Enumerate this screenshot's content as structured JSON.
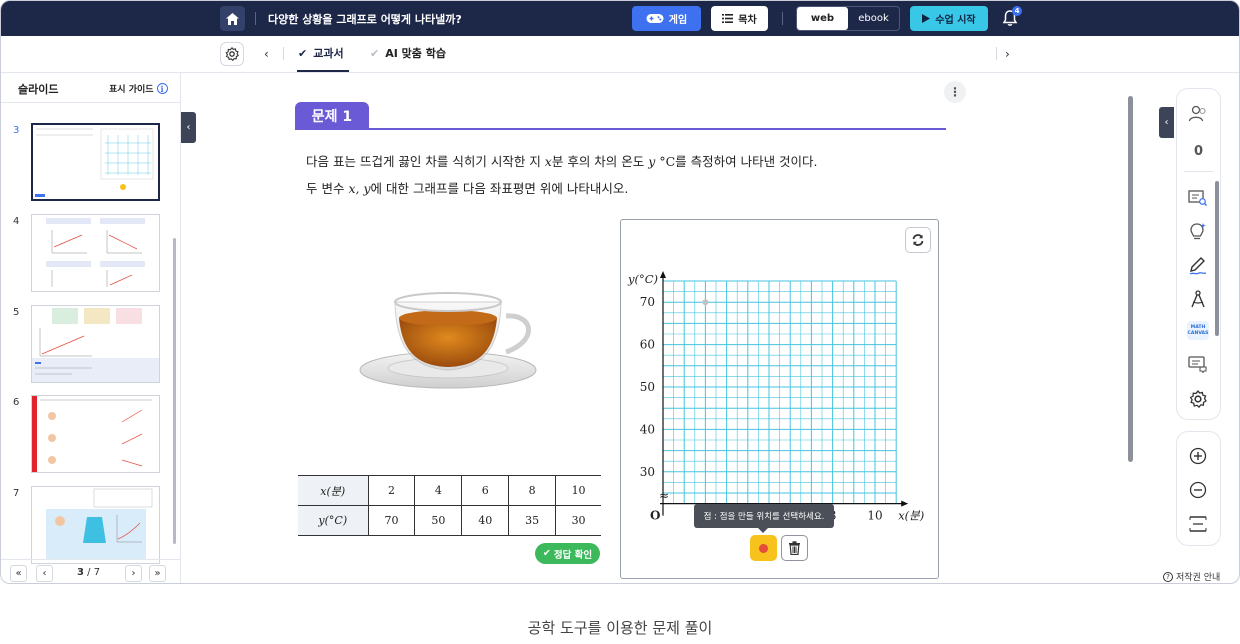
{
  "topbar": {
    "title": "다양한 상황을 그래프로 어떻게 나타낼까?",
    "game_label": "게임",
    "toc_label": "목차",
    "toggle_web": "web",
    "toggle_ebook": "ebook",
    "start_label": "수업 시작",
    "notification_count": "4"
  },
  "subbar": {
    "tabs": [
      {
        "label": "교과서",
        "active": true
      },
      {
        "label": "AI 맞춤 학습",
        "active": false
      }
    ]
  },
  "slide_panel": {
    "title": "슬라이드",
    "guide_label": "표시 가이드",
    "slides": [
      {
        "num": "3",
        "selected": true
      },
      {
        "num": "4",
        "selected": false
      },
      {
        "num": "5",
        "selected": false
      },
      {
        "num": "6",
        "selected": false
      },
      {
        "num": "7",
        "selected": false
      }
    ],
    "pager": {
      "current": "3",
      "total": "/ 7"
    }
  },
  "problem": {
    "tag": "문제 1",
    "line1_a": "다음 표는 뜨겁게 끓인 차를 식히기 시작한 지 ",
    "line1_x": "x",
    "line1_b": "분 후의 차의 온도 ",
    "line1_y": "y",
    "line1_unit": "°C",
    "line1_c": "를 측정하여 나타낸 것이다.",
    "line2_a": "두 변수 ",
    "line2_vars": "x, y",
    "line2_b": "에 대한 그래프를 다음 좌표평면 위에 나타내시오."
  },
  "table": {
    "row_x_header": "x(분)",
    "row_y_header": "y(°C)",
    "x_values": [
      "2",
      "4",
      "6",
      "8",
      "10"
    ],
    "y_values": [
      "70",
      "50",
      "40",
      "35",
      "30"
    ]
  },
  "check_button": "정답 확인",
  "graph": {
    "y_axis_label": "y(°C)",
    "x_axis_label": "x(분)",
    "origin_label": "O",
    "y_ticks": [
      "70",
      "60",
      "50",
      "40",
      "30"
    ],
    "x_ticks": [
      "2",
      "4",
      "6",
      "8",
      "10"
    ],
    "break_mark": "≈",
    "plotted_points": [
      {
        "x": 2,
        "y": 70
      }
    ],
    "tooltip": "점 : 점을 만들 위치를 선택하세요."
  },
  "right_toolbar": {
    "participant_count": "0",
    "math_canvas_line1": "MATH",
    "math_canvas_line2": "CANVAS"
  },
  "copyright_label": "저작권 안내",
  "caption": "공학 도구를 이용한 문제 풀이",
  "colors": {
    "navy": "#1d2748",
    "accent_blue": "#3d71ef",
    "problem_purple": "#6b5ad6",
    "grid_cyan": "#46c3e0",
    "check_green": "#3cb95b",
    "point_tool_yellow": "#f6c21b"
  }
}
